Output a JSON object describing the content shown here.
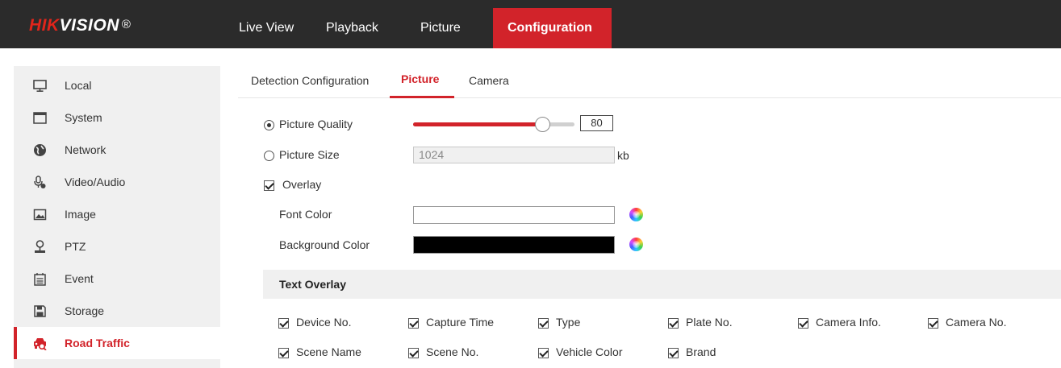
{
  "brand": {
    "hik": "HIK",
    "vision": "VISION",
    "reg": "®"
  },
  "nav": [
    {
      "label": "Live View",
      "active": false
    },
    {
      "label": "Playback",
      "active": false
    },
    {
      "label": "Picture",
      "active": false
    },
    {
      "label": "Configuration",
      "active": true
    }
  ],
  "sidebar": {
    "items": [
      {
        "label": "Local",
        "icon": "monitor-icon"
      },
      {
        "label": "System",
        "icon": "window-icon"
      },
      {
        "label": "Network",
        "icon": "globe-icon"
      },
      {
        "label": "Video/Audio",
        "icon": "microphone-icon"
      },
      {
        "label": "Image",
        "icon": "image-icon"
      },
      {
        "label": "PTZ",
        "icon": "ptz-icon"
      },
      {
        "label": "Event",
        "icon": "calendar-icon"
      },
      {
        "label": "Storage",
        "icon": "storage-icon"
      },
      {
        "label": "Road Traffic",
        "icon": "road-traffic-icon",
        "active": true
      }
    ]
  },
  "tabs": [
    {
      "label": "Detection Configuration",
      "active": false
    },
    {
      "label": "Picture",
      "active": true
    },
    {
      "label": "Camera",
      "active": false
    }
  ],
  "form": {
    "picture_quality": {
      "label": "Picture Quality",
      "selected": true,
      "value": "80",
      "slider_fraction": 0.8
    },
    "picture_size": {
      "label": "Picture Size",
      "selected": false,
      "value": "1024",
      "unit": "kb"
    },
    "overlay": {
      "label": "Overlay",
      "checked": true
    },
    "font_color": {
      "label": "Font Color",
      "value": "#ffffff"
    },
    "background_color": {
      "label": "Background Color",
      "value": "#000000"
    }
  },
  "text_overlay": {
    "title": "Text Overlay",
    "row1": [
      {
        "label": "Device No.",
        "checked": true
      },
      {
        "label": "Capture Time",
        "checked": true
      },
      {
        "label": "Type",
        "checked": true
      },
      {
        "label": "Plate No.",
        "checked": true
      },
      {
        "label": "Camera Info.",
        "checked": true
      },
      {
        "label": "Camera No.",
        "checked": true
      }
    ],
    "row2": [
      {
        "label": "Scene Name",
        "checked": true
      },
      {
        "label": "Scene No.",
        "checked": true
      },
      {
        "label": "Vehicle Color",
        "checked": true
      },
      {
        "label": "Brand",
        "checked": true
      }
    ]
  },
  "colors": {
    "accent": "#d2232a",
    "topbar": "#2b2b2b",
    "sidebar": "#f0f0f0"
  }
}
